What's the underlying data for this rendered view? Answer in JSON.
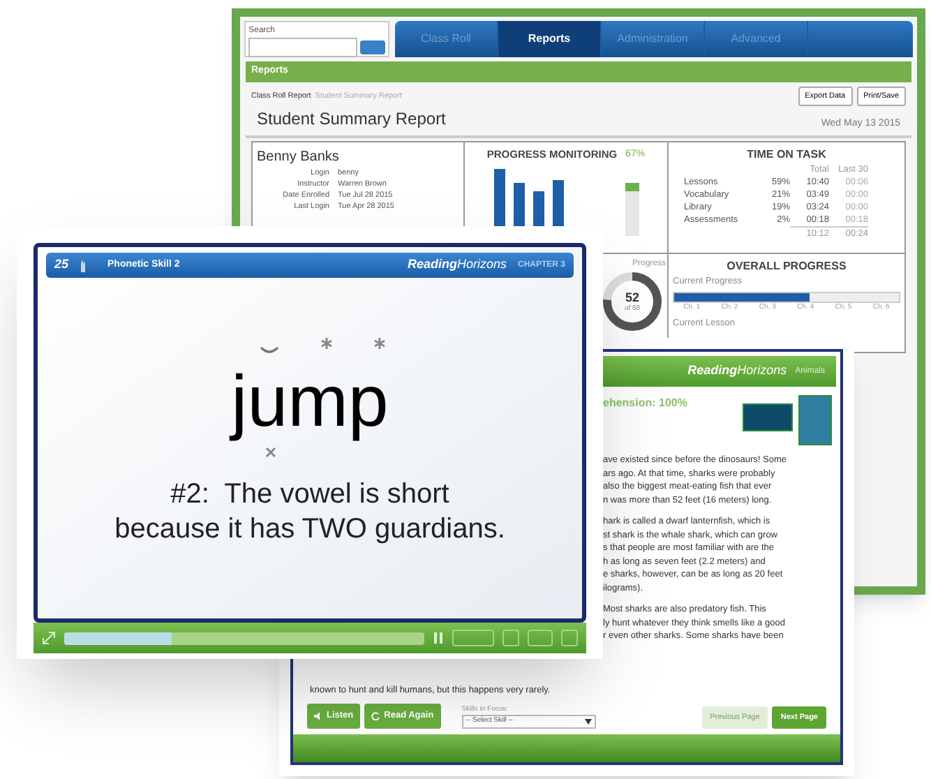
{
  "report_window": {
    "search": {
      "label": "Search"
    },
    "tabs": [
      {
        "label": "Class Roll",
        "selected": false
      },
      {
        "label": "Reports",
        "selected": true
      },
      {
        "label": "Administration",
        "selected": false
      },
      {
        "label": "Advanced",
        "selected": false
      }
    ],
    "section_bar": "Reports",
    "breadcrumb": [
      "Class Roll Report",
      "Student Summary Report"
    ],
    "actions": [
      "Export Data",
      "Print/Save"
    ],
    "title": "Student Summary Report",
    "date": "Wed May 13 2015",
    "student": {
      "name": "Benny Banks",
      "fields": [
        {
          "label": "Login",
          "value": "benny"
        },
        {
          "label": "Instructor",
          "value": "Warren Brown"
        },
        {
          "label": "Date Enrolled",
          "value": "Tue Jul 28 2015"
        },
        {
          "label": "Last Login",
          "value": "Tue Apr 28 2015"
        }
      ]
    },
    "progress_monitoring": {
      "title": "PROGRESS MONITORING",
      "percent": "67%"
    },
    "time_on_task": {
      "title": "TIME ON TASK",
      "columns": [
        "Total",
        "Last 30"
      ],
      "rows": [
        {
          "name": "Lessons",
          "share": "59%",
          "total": "10:40",
          "last": "00:06"
        },
        {
          "name": "Vocabulary",
          "share": "21%",
          "total": "03:49",
          "last": "00:00"
        },
        {
          "name": "Library",
          "share": "19%",
          "total": "03:24",
          "last": "00:00"
        },
        {
          "name": "Assessments",
          "share": "2%",
          "total": "00:18",
          "last": "00:18"
        }
      ],
      "totals": [
        "10:12",
        "00:24"
      ]
    },
    "progress_dial": {
      "label": "Progress",
      "value": "52",
      "of": "of 68",
      "level": 0.76
    },
    "overall_progress": {
      "title": "OVERALL PROGRESS",
      "current_label": "Current Progress",
      "level": 0.6,
      "chapters": [
        "Ch. 1",
        "Ch. 2",
        "Ch. 3",
        "Ch. 4",
        "Ch. 5",
        "Ch. 6"
      ],
      "lesson_label": "Current Lesson"
    }
  },
  "lesson_window": {
    "number": "25",
    "skill": "Phonetic Skill 2",
    "brand": "**Reading**Horizons",
    "chapter": "CHAPTER 3",
    "word": "jump",
    "rule": [
      "#2:  The vowel is short",
      "because it has TWO guardians."
    ],
    "progress": {
      "level": 0.3
    }
  },
  "reading_window": {
    "brand": "**Reading**Horizons",
    "topic": "Animals",
    "score": "ehension: 100%",
    "paragraphs": [
      [
        "ave existed since before the dinosaurs! Some",
        "ars ago. At that time, sharks were probably",
        "also the biggest meat-eating fish that ever",
        "n was more than 52  feet (16 meters) long."
      ],
      [
        "hark is called a dwarf lanternfish, which is",
        "st shark is the whale shark, which can grow",
        "s that people are most familiar with are the",
        "h as long as seven feet (2.2 meters) and",
        "e sharks, however, can be as long as 20 feet",
        "ilograms)."
      ],
      [
        "Most sharks are also predatory fish. This",
        "ly hunt whatever they think smells like a good",
        "r even other sharks. Some sharks have been"
      ]
    ],
    "last_line": "known to hunt and kill humans, but this happens very rarely.",
    "buttons": [
      {
        "label": "Listen",
        "kind": "listen"
      },
      {
        "label": "Read Again",
        "kind": "again"
      }
    ],
    "skill_select": {
      "label": "Skills in Focus:",
      "value": "-- Select Skill --"
    },
    "pager": [
      {
        "label": "Previous Page",
        "disabled": true
      },
      {
        "label": "Next Page",
        "disabled": false
      }
    ]
  }
}
